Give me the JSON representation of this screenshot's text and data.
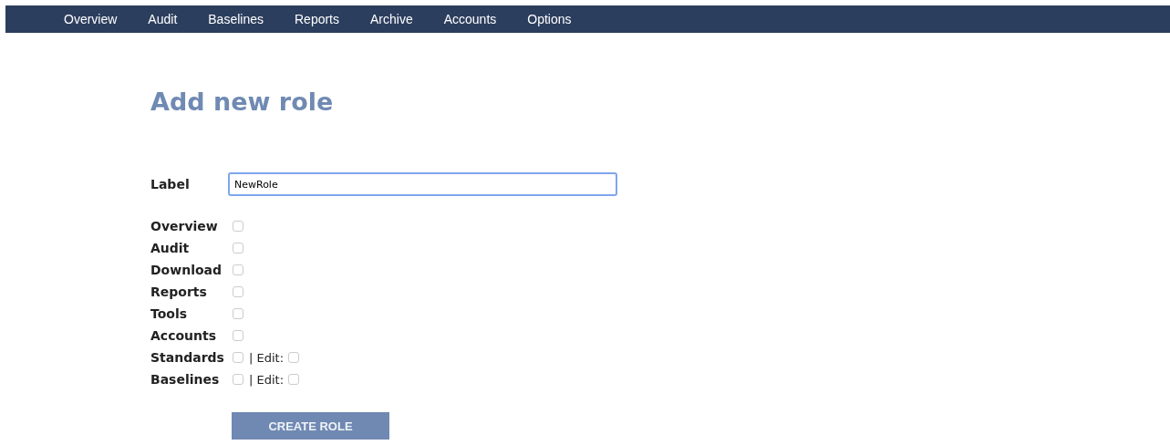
{
  "nav": [
    {
      "label": "Overview"
    },
    {
      "label": "Audit"
    },
    {
      "label": "Baselines"
    },
    {
      "label": "Reports"
    },
    {
      "label": "Archive"
    },
    {
      "label": "Accounts"
    },
    {
      "label": "Options"
    }
  ],
  "heading": "Add new role",
  "label_field": {
    "label": "Label",
    "value": "NewRole",
    "focused": true
  },
  "permissions": [
    {
      "label": "Overview",
      "checked": false
    },
    {
      "label": "Audit",
      "checked": false
    },
    {
      "label": "Download",
      "checked": false
    },
    {
      "label": "Reports",
      "checked": false
    },
    {
      "label": "Tools",
      "checked": false
    },
    {
      "label": "Accounts",
      "checked": false
    },
    {
      "label": "Standards",
      "checked": false,
      "edit": {
        "label": "| Edit:",
        "checked": false
      }
    },
    {
      "label": "Baselines",
      "checked": false,
      "edit": {
        "label": "| Edit:",
        "checked": false
      }
    }
  ],
  "submit": "CREATE ROLE"
}
